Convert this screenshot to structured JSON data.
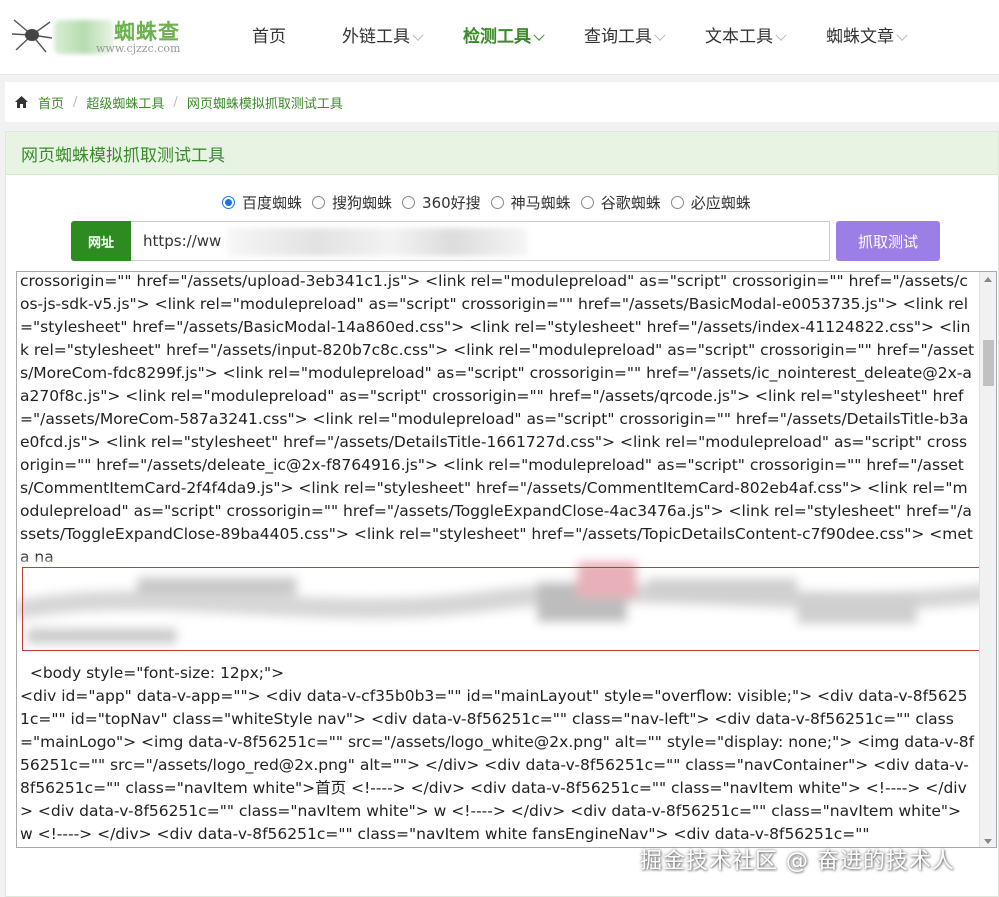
{
  "logo": {
    "name": "蜘蛛查",
    "url": "www.cjzzc.com"
  },
  "nav": [
    {
      "label": "首页",
      "has_menu": false,
      "active": false
    },
    {
      "label": "外链工具",
      "has_menu": true,
      "active": false
    },
    {
      "label": "检测工具",
      "has_menu": true,
      "active": true
    },
    {
      "label": "查询工具",
      "has_menu": true,
      "active": false
    },
    {
      "label": "文本工具",
      "has_menu": true,
      "active": false
    },
    {
      "label": "蜘蛛文章",
      "has_menu": true,
      "active": false
    }
  ],
  "breadcrumb": {
    "home": "首页",
    "level1": "超级蜘蛛工具",
    "level2": "网页蜘蛛模拟抓取测试工具"
  },
  "panel": {
    "title": "网页蜘蛛模拟抓取测试工具"
  },
  "spiders": [
    {
      "label": "百度蜘蛛",
      "checked": true
    },
    {
      "label": "搜狗蜘蛛",
      "checked": false
    },
    {
      "label": "360好搜",
      "checked": false
    },
    {
      "label": "神马蜘蛛",
      "checked": false
    },
    {
      "label": "谷歌蜘蛛",
      "checked": false
    },
    {
      "label": "必应蜘蛛",
      "checked": false
    }
  ],
  "url_field": {
    "label": "网址",
    "value": "https://ww"
  },
  "submit_label": "抓取测试",
  "result_lines": [
    "crossorigin=\"\" href=\"/assets/upload-3eb341c1.js\"> <link rel=\"modulepreload\" as=\"script\" crossorigin=\"\" href=\"/assets/cos-js-sdk-v5.js\"> <link rel=\"modulepreload\" as=\"script\" crossorigin=\"\" href=\"/assets/BasicModal-e0053735.js\"> <link rel=\"stylesheet\" href=\"/assets/BasicModal-14a860ed.css\"> <link rel=\"stylesheet\" href=\"/assets/index-41124822.css\"> <link rel=\"stylesheet\" href=\"/assets/input-820b7c8c.css\"> <link rel=\"modulepreload\" as=\"script\" crossorigin=\"\" href=\"/assets/MoreCom-fdc8299f.js\"> <link rel=\"modulepreload\" as=\"script\" crossorigin=\"\" href=\"/assets/ic_nointerest_deleate@2x-aa270f8c.js\"> <link rel=\"modulepreload\" as=\"script\" crossorigin=\"\" href=\"/assets/qrcode.js\"> <link rel=\"stylesheet\" href=\"/assets/MoreCom-587a3241.css\"> <link rel=\"modulepreload\" as=\"script\" crossorigin=\"\" href=\"/assets/DetailsTitle-b3ae0fcd.js\"> <link rel=\"stylesheet\" href=\"/assets/DetailsTitle-1661727d.css\"> <link rel=\"modulepreload\" as=\"script\" crossorigin=\"\" href=\"/assets/deleate_ic@2x-f8764916.js\"> <link rel=\"modulepreload\" as=\"script\" crossorigin=\"\" href=\"/assets/CommentItemCard-2f4f4da9.js\"> <link rel=\"stylesheet\" href=\"/assets/CommentItemCard-802eb4af.css\"> <link rel=\"modulepreload\" as=\"script\" crossorigin=\"\" href=\"/assets/ToggleExpandClose-4ac3476a.js\"> <link rel=\"stylesheet\" href=\"/assets/ToggleExpandClose-89ba4405.css\"> <link rel=\"stylesheet\" href=\"/assets/TopicDetailsContent-c7f90dee.css\"> <meta na"
  ],
  "body_lines": [
    "  <body style=\"font-size: 12px;\">",
    "    <div id=\"app\" data-v-app=\"\"> <div data-v-cf35b0b3=\"\" id=\"mainLayout\" style=\"overflow: visible;\"> <div data-v-8f56251c=\"\" id=\"topNav\" class=\"whiteStyle nav\"> <div data-v-8f56251c=\"\" class=\"nav-left\"> <div data-v-8f56251c=\"\" class=\"mainLogo\"> <img data-v-8f56251c=\"\" src=\"/assets/logo_white@2x.png\" alt=\"\" style=\"display: none;\"> <img data-v-8f56251c=\"\" src=\"/assets/logo_red@2x.png\" alt=\"\"> </div> <div data-v-8f56251c=\"\" class=\"navContainer\"> <div data-v-8f56251c=\"\" class=\"navItem white\">首页 <!----> </div> <div data-v-8f56251c=\"\" class=\"navItem white\"> <!----> </div> <div data-v-8f56251c=\"\" class=\"navItem white\"> w <!----> </div> <div data-v-8f56251c=\"\" class=\"navItem white\"> w <!----> </div> <div data-v-8f56251c=\"\" class=\"navItem white fansEngineNav\"> <div data-v-8f56251c=\"\""
  ],
  "watermark": "掘金技术社区 @ 奋进的技术人",
  "colors": {
    "brand_green": "#3b8a2a",
    "button_purple": "#9b7fe6",
    "highlight_red": "#c23b3b"
  }
}
